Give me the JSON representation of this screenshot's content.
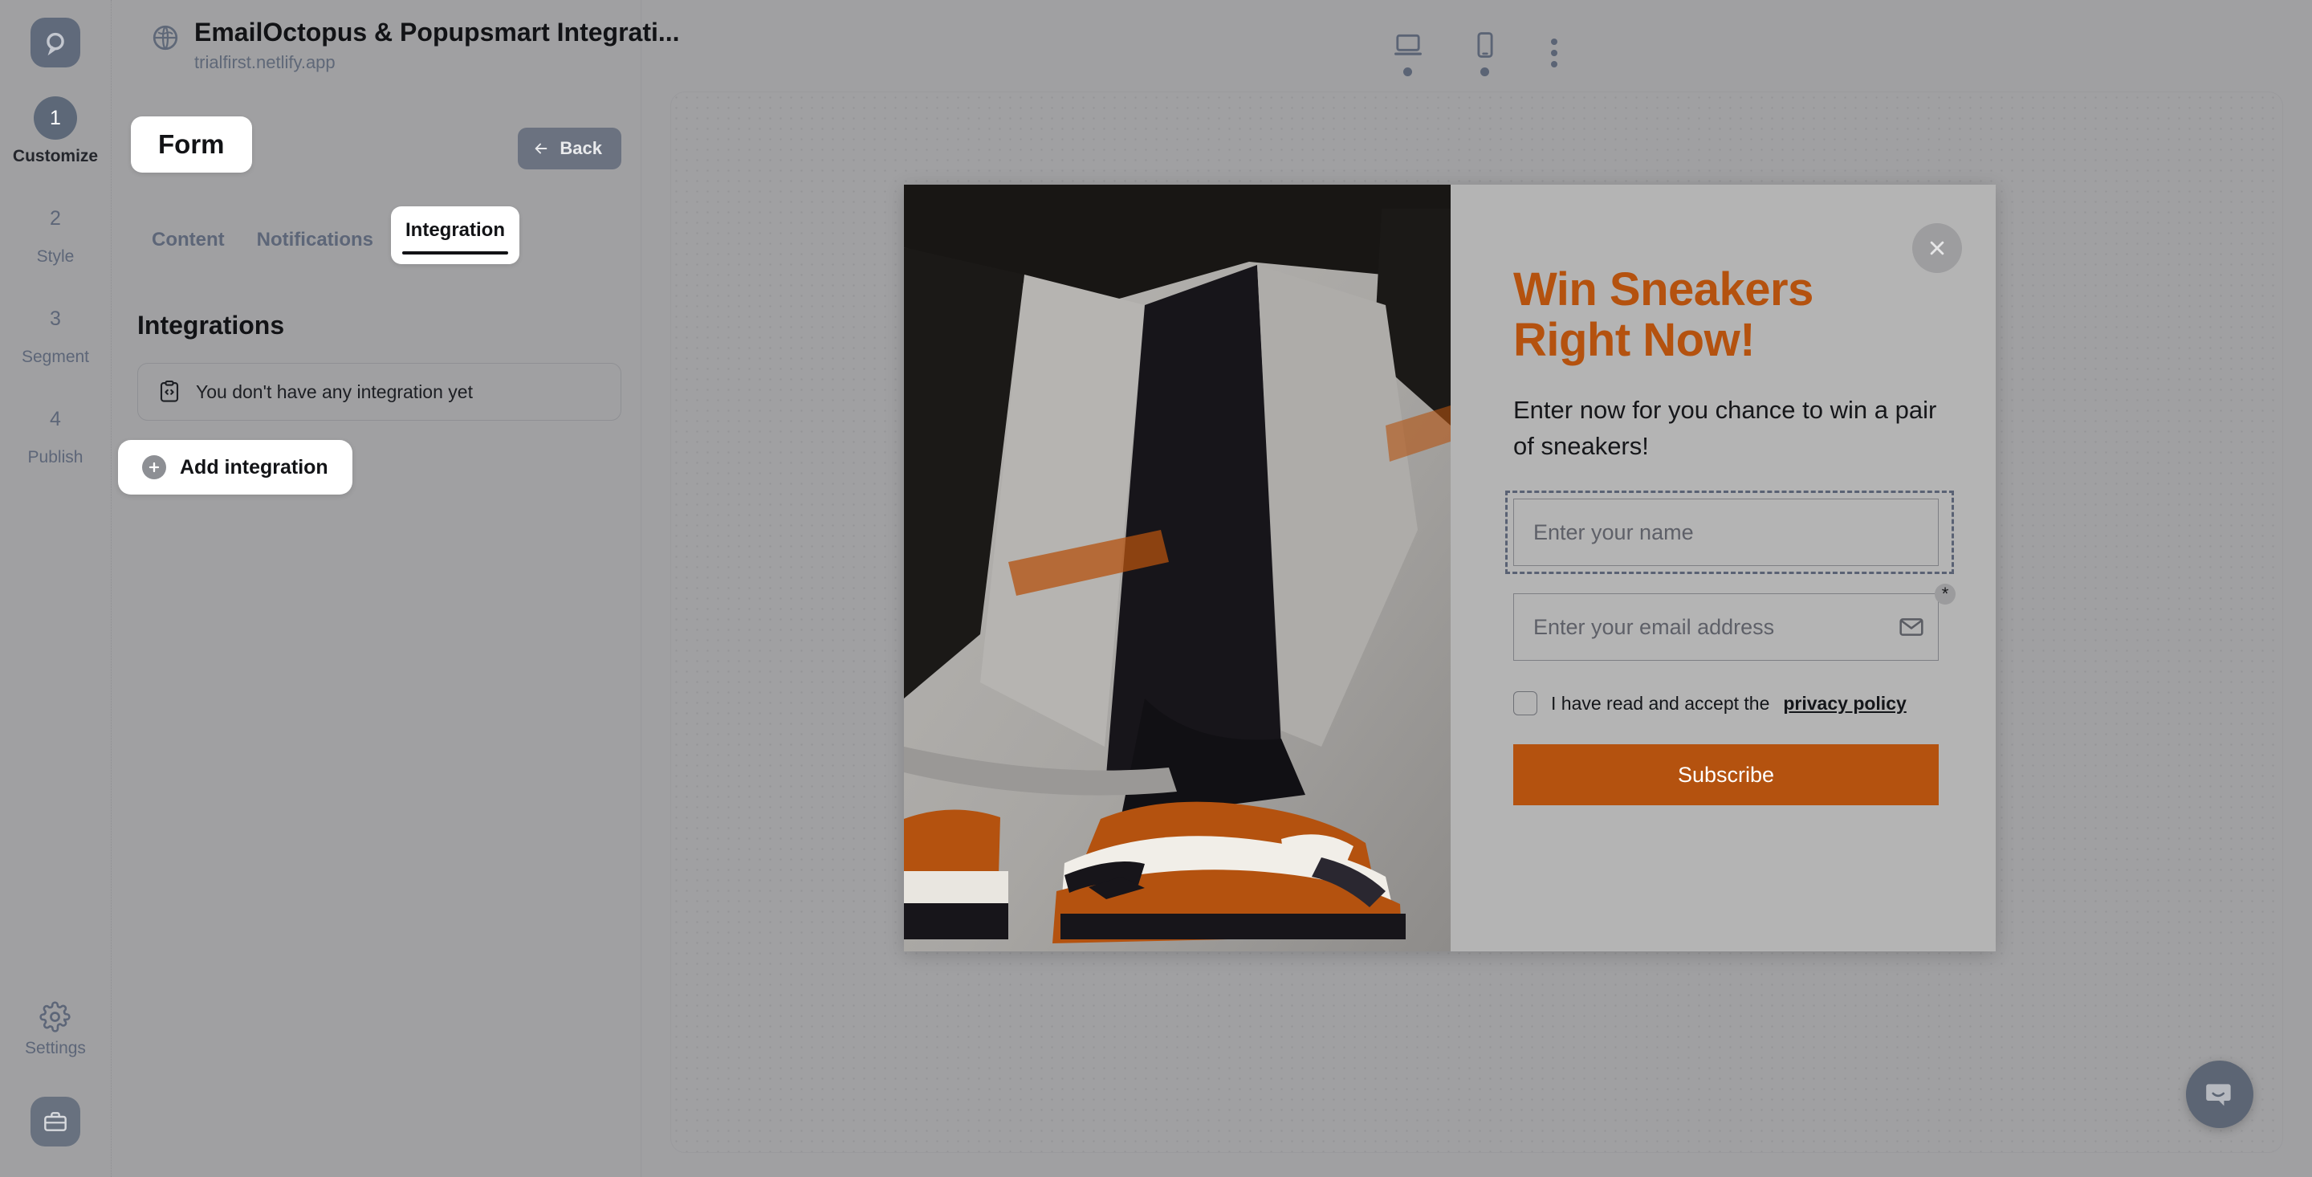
{
  "header": {
    "title": "EmailOctopus & Popupsmart Integrati...",
    "url": "trialfirst.netlify.app",
    "globe_icon": "globe-icon",
    "brand_icon": "popupsmart-logo"
  },
  "toolbar": {
    "desktop_label": "desktop-view",
    "mobile_label": "mobile-view",
    "more_label": "more-options"
  },
  "rail": {
    "steps": [
      {
        "number": "1",
        "label": "Customize",
        "active": true
      },
      {
        "number": "2",
        "label": "Style",
        "active": false
      },
      {
        "number": "3",
        "label": "Segment",
        "active": false
      },
      {
        "number": "4",
        "label": "Publish",
        "active": false
      }
    ],
    "settings_label": "Settings",
    "settings_icon": "gear-icon",
    "briefcase_icon": "briefcase-icon"
  },
  "panel": {
    "chip_label": "Form",
    "back_label": "Back",
    "tabs": [
      {
        "label": "Content",
        "active": false
      },
      {
        "label": "Notifications",
        "active": false
      },
      {
        "label": "Integration",
        "active": true
      }
    ],
    "section_title": "Integrations",
    "empty_state": "You don't have any integration yet",
    "empty_icon": "code-clipboard-icon",
    "add_button": "Add integration",
    "add_icon": "plus-circle-icon"
  },
  "popup": {
    "title_line1": "Win Sneakers",
    "title_line2": "Right Now!",
    "subtitle": "Enter now for you chance to win a pair of sneakers!",
    "name_placeholder": "Enter your name",
    "email_placeholder": "Enter your email address",
    "email_icon": "envelope-icon",
    "required_marker": "*",
    "consent_text": "I have read and accept the",
    "consent_link": "privacy policy",
    "submit_label": "Subscribe",
    "close_icon": "close-icon",
    "accent_color": "#b4520f",
    "background_color": "#b4b4b4",
    "image_alt": "orange-nike-air-max-sneakers"
  },
  "chat": {
    "icon": "chat-bubble-icon"
  }
}
